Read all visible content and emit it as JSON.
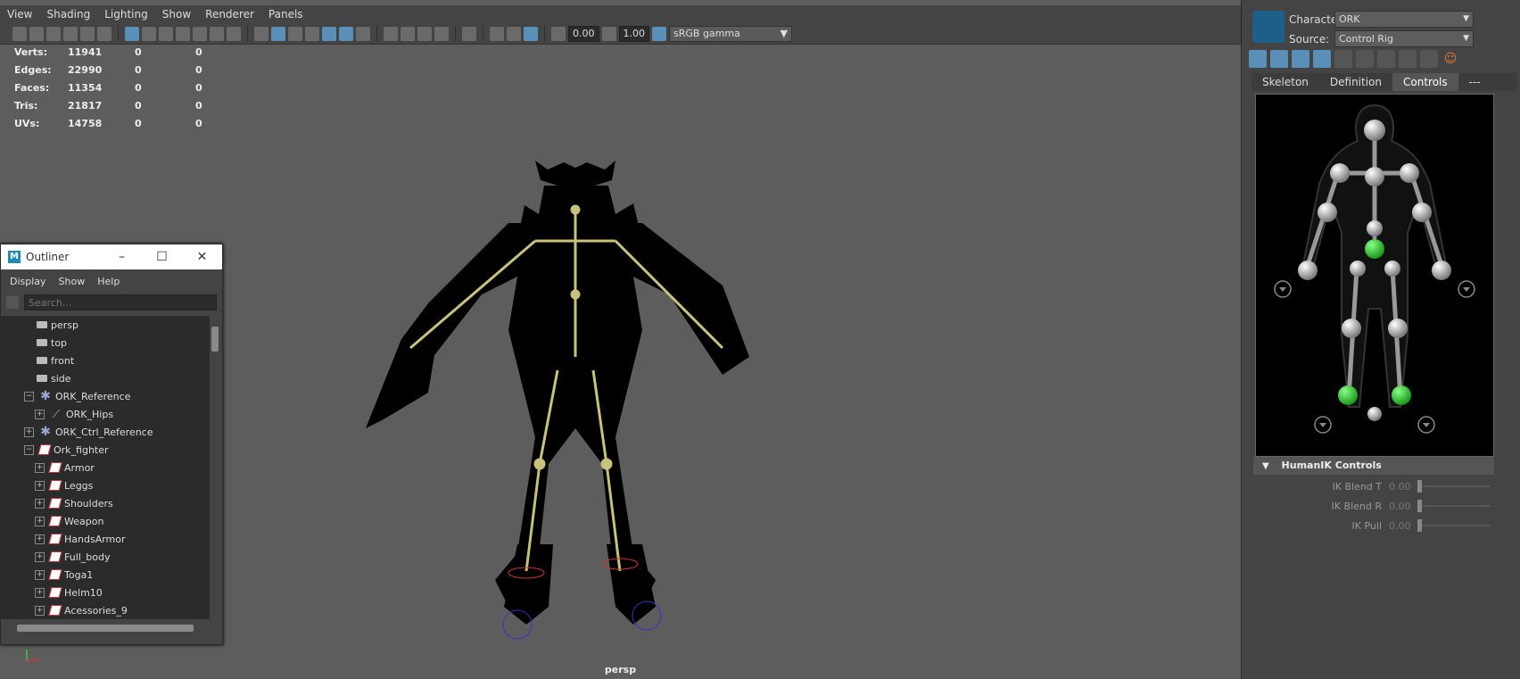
{
  "viewport": {
    "menu": [
      "View",
      "Shading",
      "Lighting",
      "Show",
      "Renderer",
      "Panels"
    ],
    "toolbar": {
      "exposure": "0.00",
      "gamma": "1.00",
      "color_space": "sRGB gamma"
    },
    "hud": [
      {
        "label": "Verts:",
        "v1": "11941",
        "v2": "0",
        "v3": "0"
      },
      {
        "label": "Edges:",
        "v1": "22990",
        "v2": "0",
        "v3": "0"
      },
      {
        "label": "Faces:",
        "v1": "11354",
        "v2": "0",
        "v3": "0"
      },
      {
        "label": "Tris:",
        "v1": "21817",
        "v2": "0",
        "v3": "0"
      },
      {
        "label": "UVs:",
        "v1": "14758",
        "v2": "0",
        "v3": "0"
      }
    ],
    "camera_label": "persp"
  },
  "outliner": {
    "title": "Outliner",
    "menu": [
      "Display",
      "Show",
      "Help"
    ],
    "search_placeholder": "Search...",
    "items": [
      {
        "label": "persp",
        "icon": "camera-icon",
        "depth": 0,
        "expand": ""
      },
      {
        "label": "top",
        "icon": "camera-icon",
        "depth": 0,
        "expand": ""
      },
      {
        "label": "front",
        "icon": "camera-icon",
        "depth": 0,
        "expand": ""
      },
      {
        "label": "side",
        "icon": "camera-icon",
        "depth": 0,
        "expand": ""
      },
      {
        "label": "ORK_Reference",
        "icon": "character-icon",
        "depth": 0,
        "expand": "−"
      },
      {
        "label": "ORK_Hips",
        "icon": "joint-icon",
        "depth": 1,
        "expand": "+"
      },
      {
        "label": "ORK_Ctrl_Reference",
        "icon": "character-icon",
        "depth": 0,
        "expand": "+"
      },
      {
        "label": "Ork_fighter",
        "icon": "mesh-icon",
        "depth": 0,
        "expand": "−"
      },
      {
        "label": "Armor",
        "icon": "mesh-icon",
        "depth": 1,
        "expand": "+"
      },
      {
        "label": "Leggs",
        "icon": "mesh-icon",
        "depth": 1,
        "expand": "+"
      },
      {
        "label": "Shoulders",
        "icon": "mesh-icon",
        "depth": 1,
        "expand": "+"
      },
      {
        "label": "Weapon",
        "icon": "mesh-icon",
        "depth": 1,
        "expand": "+"
      },
      {
        "label": "HandsArmor",
        "icon": "mesh-icon",
        "depth": 1,
        "expand": "+"
      },
      {
        "label": "Full_body",
        "icon": "mesh-icon",
        "depth": 1,
        "expand": "+"
      },
      {
        "label": "Toga1",
        "icon": "mesh-icon",
        "depth": 1,
        "expand": "+"
      },
      {
        "label": "Helm10",
        "icon": "mesh-icon",
        "depth": 1,
        "expand": "+"
      },
      {
        "label": "Acessories_9",
        "icon": "mesh-icon",
        "depth": 1,
        "expand": "+"
      }
    ]
  },
  "humanik": {
    "character_label": "Character:",
    "character_value": "ORK",
    "source_label": "Source:",
    "source_value": "Control Rig",
    "tabs": [
      "Skeleton",
      "Definition",
      "Controls",
      "---"
    ],
    "active_tab": "Controls",
    "controls_header": "HumanIK Controls",
    "sliders": [
      {
        "label": "IK Blend T",
        "value": "0.00"
      },
      {
        "label": "IK Blend R",
        "value": "0.00"
      },
      {
        "label": "IK Pull",
        "value": "0.00"
      }
    ]
  },
  "colors": {
    "selection": "#5a8fb8",
    "rig_bones": "#c8c27a",
    "effector_active": "#33cc33"
  }
}
